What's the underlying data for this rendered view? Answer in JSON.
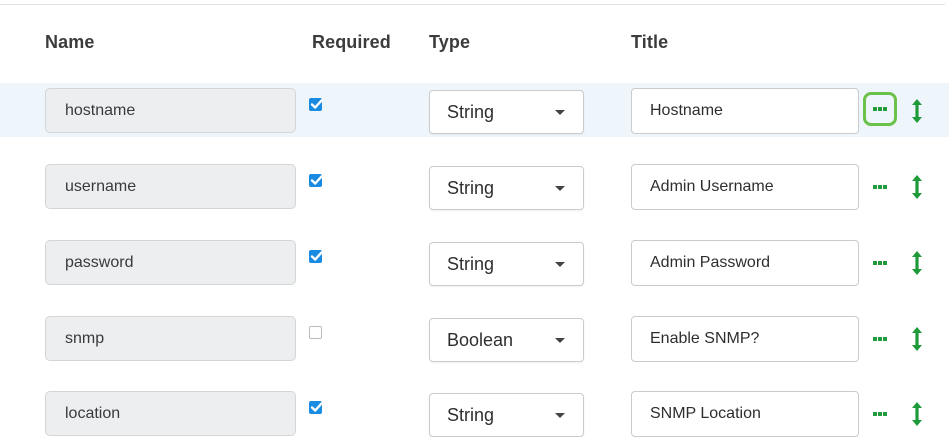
{
  "colors": {
    "accent_green": "#1f9a3a",
    "focus_ring": "#6bc24a",
    "checkbox_blue": "#1a8be2",
    "row_highlight": "#eef6fc"
  },
  "header": {
    "name": "Name",
    "required": "Required",
    "type": "Type",
    "title": "Title"
  },
  "rows": [
    {
      "name": "hostname",
      "required": true,
      "type": "String",
      "title": "Hostname",
      "highlighted": true,
      "more_focused": true
    },
    {
      "name": "username",
      "required": true,
      "type": "String",
      "title": "Admin Username",
      "highlighted": false,
      "more_focused": false
    },
    {
      "name": "password",
      "required": true,
      "type": "String",
      "title": "Admin Password",
      "highlighted": false,
      "more_focused": false
    },
    {
      "name": "snmp",
      "required": false,
      "type": "Boolean",
      "title": "Enable SNMP?",
      "highlighted": false,
      "more_focused": false
    },
    {
      "name": "location",
      "required": true,
      "type": "String",
      "title": "SNMP Location",
      "highlighted": false,
      "more_focused": false
    }
  ],
  "icons": {
    "more": "ellipsis-icon",
    "move": "vertical-arrows-icon",
    "checkbox": "checkmark-icon",
    "caret": "caret-down-icon"
  }
}
